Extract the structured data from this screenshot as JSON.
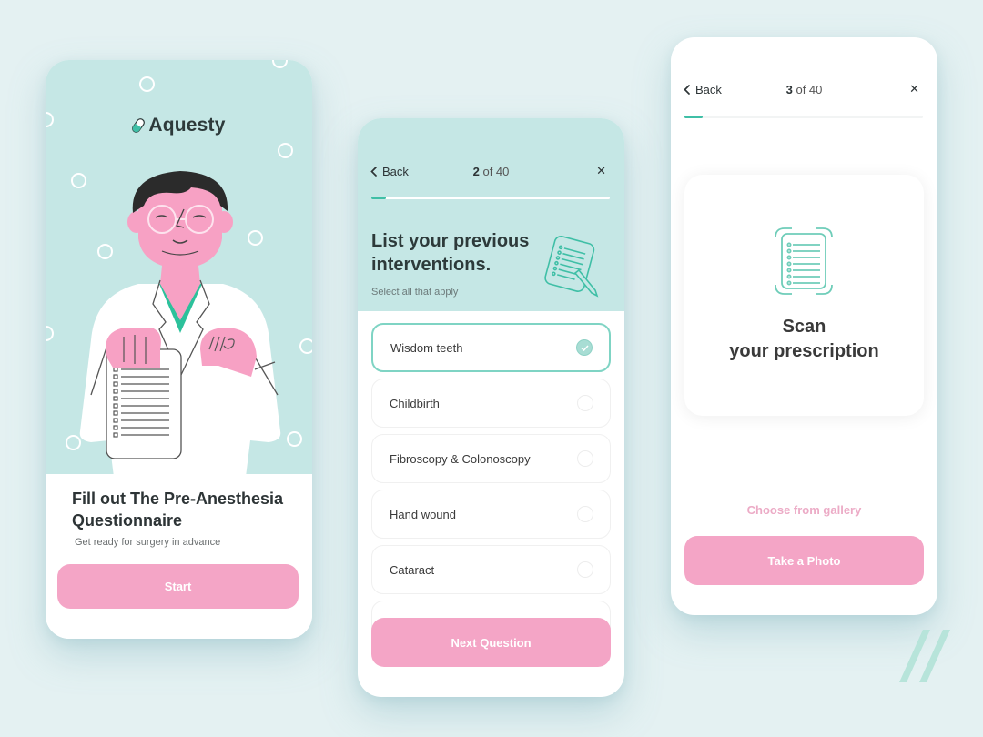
{
  "colors": {
    "background": "#e4f1f2",
    "mint": "#c5e7e5",
    "accent_teal": "#3fbfa6",
    "pink": "#f4a5c6",
    "text_dark": "#2d3436"
  },
  "welcome_screen": {
    "logo": {
      "icon": "pill-icon",
      "text": "Aquesty"
    },
    "illustration": "doctor-holding-checklist",
    "title": "Fill out The Pre-Anesthesia Questionnaire",
    "subtitle": "Get ready for surgery in advance",
    "start_button": "Start"
  },
  "question_screen": {
    "nav": {
      "back_label": "Back",
      "current": "2",
      "of_total": "of 40",
      "close_icon": "close-icon"
    },
    "progress": {
      "current": 2,
      "total": 40
    },
    "question_title": "List your previous interventions.",
    "question_hint": "Select all that apply",
    "question_icon": "checklist-pen-icon",
    "options": [
      {
        "label": "Wisdom teeth",
        "selected": true
      },
      {
        "label": "Childbirth",
        "selected": false
      },
      {
        "label": "Fibroscopy & Colonoscopy",
        "selected": false
      },
      {
        "label": "Hand wound",
        "selected": false
      },
      {
        "label": "Cataract",
        "selected": false
      }
    ],
    "next_button": "Next Question"
  },
  "scan_screen": {
    "nav": {
      "back_label": "Back",
      "current": "3",
      "of_total": "of 40",
      "close_icon": "close-icon"
    },
    "progress": {
      "current": 3,
      "total": 40
    },
    "scan_icon": "document-scan-icon",
    "scan_title_line1": "Scan",
    "scan_title_line2": "your prescription",
    "gallery_link": "Choose from gallery",
    "photo_button": "Take a Photo"
  }
}
